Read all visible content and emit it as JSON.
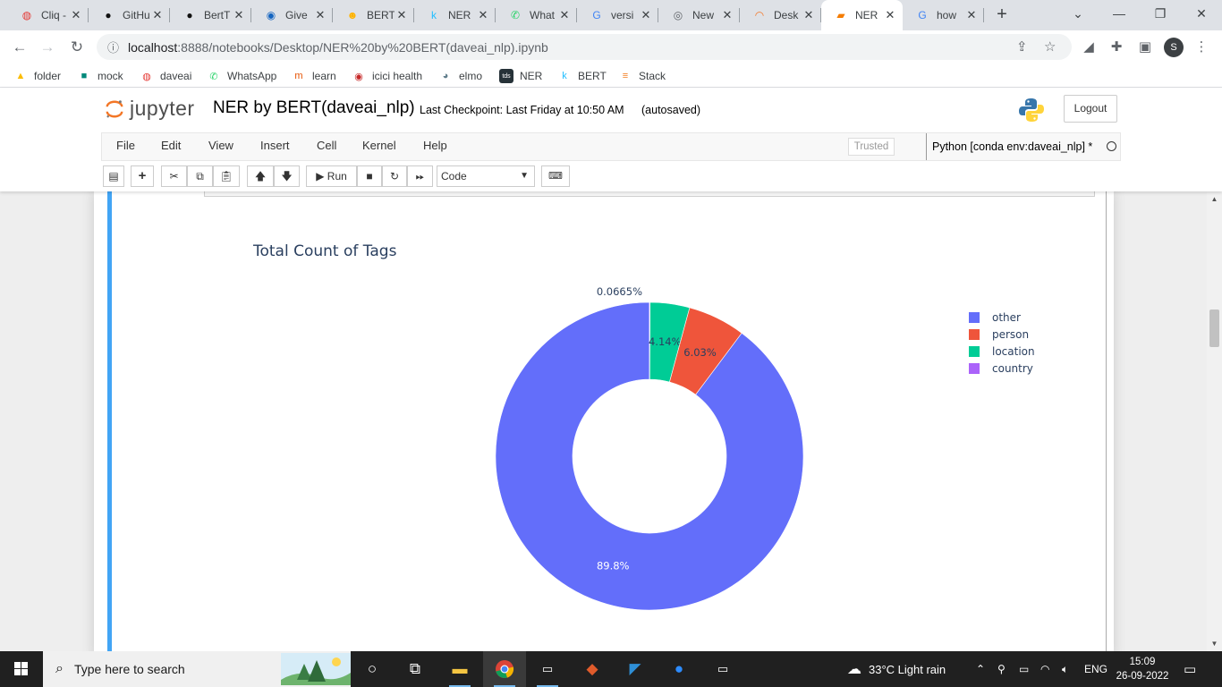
{
  "browser": {
    "tabs": [
      {
        "title": "Cliq - ",
        "icon": "zoho-icon",
        "color": "#e53935",
        "glyph": "◍"
      },
      {
        "title": "GitHu",
        "icon": "github-icon",
        "color": "#111111",
        "glyph": "●"
      },
      {
        "title": "BertT",
        "icon": "github-icon",
        "color": "#111111",
        "glyph": "●"
      },
      {
        "title": "Give",
        "icon": "gov-icon",
        "color": "#1565c0",
        "glyph": "◉"
      },
      {
        "title": "BERT",
        "icon": "huggingface-icon",
        "color": "#ffb300",
        "glyph": "☻"
      },
      {
        "title": "NER",
        "icon": "kaggle-icon",
        "color": "#20beff",
        "glyph": "k"
      },
      {
        "title": "What",
        "icon": "whatsapp-icon",
        "color": "#25d366",
        "glyph": "✆"
      },
      {
        "title": "versi",
        "icon": "google-icon",
        "color": "#4285f4",
        "glyph": "G"
      },
      {
        "title": "New",
        "icon": "chrome-icon",
        "color": "#5f6368",
        "glyph": "◎"
      },
      {
        "title": "Desk",
        "icon": "jupyter-icon",
        "color": "#f37626",
        "glyph": "◠"
      },
      {
        "title": "NER",
        "icon": "notebook-icon",
        "color": "#f57c00",
        "glyph": "▰",
        "active": true
      },
      {
        "title": "how",
        "icon": "google-icon",
        "color": "#4285f4",
        "glyph": "G"
      }
    ],
    "url_host": "localhost",
    "url_rest": ":8888/notebooks/Desktop/NER%20by%20BERT(daveai_nlp).ipynb",
    "profile_initial": "S",
    "bookmarks": [
      {
        "label": "folder",
        "icon": "drive-icon",
        "color": "#fbbc04",
        "glyph": "▲"
      },
      {
        "label": "mock",
        "icon": "meet-icon",
        "color": "#00897b",
        "glyph": "■"
      },
      {
        "label": "daveai",
        "icon": "zoho-icon",
        "color": "#e53935",
        "glyph": "◍"
      },
      {
        "label": "WhatsApp",
        "icon": "whatsapp-icon",
        "color": "#25d366",
        "glyph": "✆"
      },
      {
        "label": "learn",
        "icon": "learn-icon",
        "color": "#e65100",
        "glyph": "m"
      },
      {
        "label": "icici health",
        "icon": "icici-icon",
        "color": "#c62828",
        "glyph": "◉"
      },
      {
        "label": "elmo",
        "icon": "elmo-icon",
        "color": "#607d8b",
        "glyph": "◕"
      },
      {
        "label": "NER",
        "icon": "tds-icon",
        "color": "#263238",
        "glyph": "tds"
      },
      {
        "label": "BERT",
        "icon": "kaggle-icon",
        "color": "#20beff",
        "glyph": "k"
      },
      {
        "label": "Stack",
        "icon": "stackoverflow-icon",
        "color": "#f48024",
        "glyph": "≡"
      }
    ]
  },
  "jupyter": {
    "logo_text": "jupyter",
    "notebook_name": "NER by BERT(daveai_nlp)",
    "checkpoint": "Last Checkpoint: Last Friday at 10:50 AM",
    "autosaved": "(autosaved)",
    "logout": "Logout",
    "menus": [
      "File",
      "Edit",
      "View",
      "Insert",
      "Cell",
      "Kernel",
      "Help"
    ],
    "trusted": "Trusted",
    "kernel": "Python [conda env:daveai_nlp] *",
    "run_label": "Run",
    "cell_type": "Code"
  },
  "chart_data": {
    "type": "pie",
    "hole": 0.5,
    "title": "Total Count of Tags",
    "labels": [
      "other",
      "person",
      "location",
      "country"
    ],
    "values": [
      89.8,
      6.03,
      4.14,
      0.0665
    ],
    "text_labels": [
      "89.8%",
      "6.03%",
      "4.14%",
      "0.0665%"
    ],
    "colors": [
      "#636efa",
      "#ef553b",
      "#00cc96",
      "#ab63fa"
    ],
    "legend_position": "top-right"
  },
  "taskbar": {
    "search_placeholder": "Type here to search",
    "weather": "33°C  Light rain",
    "language": "ENG",
    "time": "15:09",
    "date": "26-09-2022"
  }
}
